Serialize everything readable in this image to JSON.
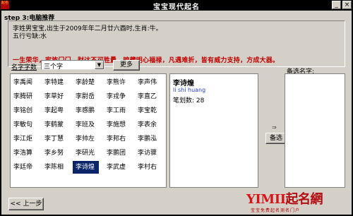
{
  "app": {
    "title": "宝宝现代起名",
    "logo_text": "起名"
  },
  "titlebar": {
    "minimize_label": "_",
    "close_label": "×"
  },
  "step": "step 3:电脑推荐",
  "info": {
    "line1": "李姓男宝宝,出生于2009年年二月廿六酉时,生肖:牛。",
    "line2": "五行亏缺:水",
    "slogan": "一生荣华，家族门门，财达不可胜量，暗藏明心福禄，凡遇难折，皆有威力支持，方成大器。"
  },
  "controls": {
    "count_label": "名字字数",
    "count_value": "三个字",
    "more_button": "更多",
    "pick_button": "备选",
    "back_button": "<< 上一步",
    "backup_label": "备选名字:",
    "arrow": "⇒"
  },
  "names": [
    [
      "李禹闻",
      "李特建",
      "李龄楚",
      "李熊许",
      "李声伟"
    ],
    [
      "李腾研",
      "李草好",
      "李尉岳",
      "李戎争",
      "李直乙"
    ],
    [
      "李铭创",
      "李起粤",
      "李感鹏",
      "李工雨",
      "李宝乾"
    ],
    [
      "李敏句",
      "李鹤蒙",
      "李班及",
      "李施想",
      "李表余"
    ],
    [
      "李江炬",
      "李丁慧",
      "李帅左",
      "李邦右",
      "李鹏泓"
    ],
    [
      "李浩算",
      "李乡努",
      "李研光",
      "李鹏团",
      "李访骤"
    ],
    [
      "李廷帝",
      "李陈相",
      "李诗煌",
      "李武虚",
      "李村右"
    ]
  ],
  "selected": {
    "row": 6,
    "col": 2,
    "name": "李诗煌",
    "pinyin": "li shi huang",
    "strokes": "笔划数: 28"
  },
  "watermark": {
    "brand": "YIMII",
    "site": "起名網",
    "tagline": "宝宝免费起名测名门户"
  },
  "colors": {
    "accent_red": "#c00000",
    "selection": "#0a246a",
    "pinyin_blue": "#2a3fd0"
  }
}
